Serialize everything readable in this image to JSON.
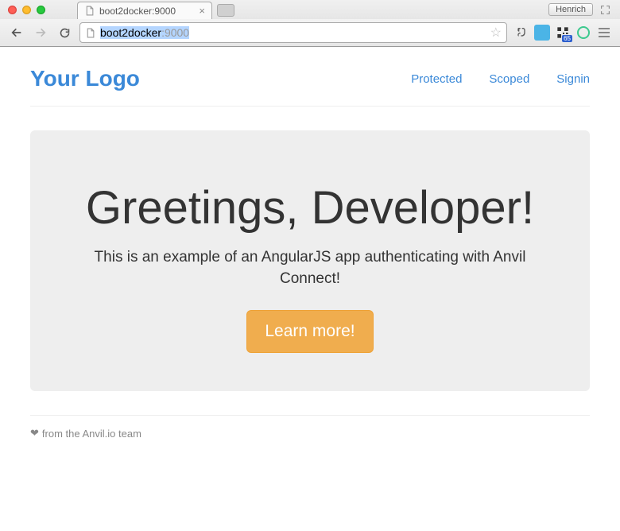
{
  "browser": {
    "tab_title": "boot2docker:9000",
    "user_label": "Henrich",
    "url_host": "boot2docker",
    "url_port": ":9000",
    "qr_badge": "65"
  },
  "header": {
    "logo": "Your Logo",
    "links": [
      {
        "label": "Protected"
      },
      {
        "label": "Scoped"
      },
      {
        "label": "Signin"
      }
    ]
  },
  "jumbo": {
    "heading": "Greetings, Developer!",
    "subtext": "This is an example of an AngularJS app authenticating with Anvil Connect!",
    "cta": "Learn more!"
  },
  "footer": {
    "text": " from the Anvil.io team"
  }
}
